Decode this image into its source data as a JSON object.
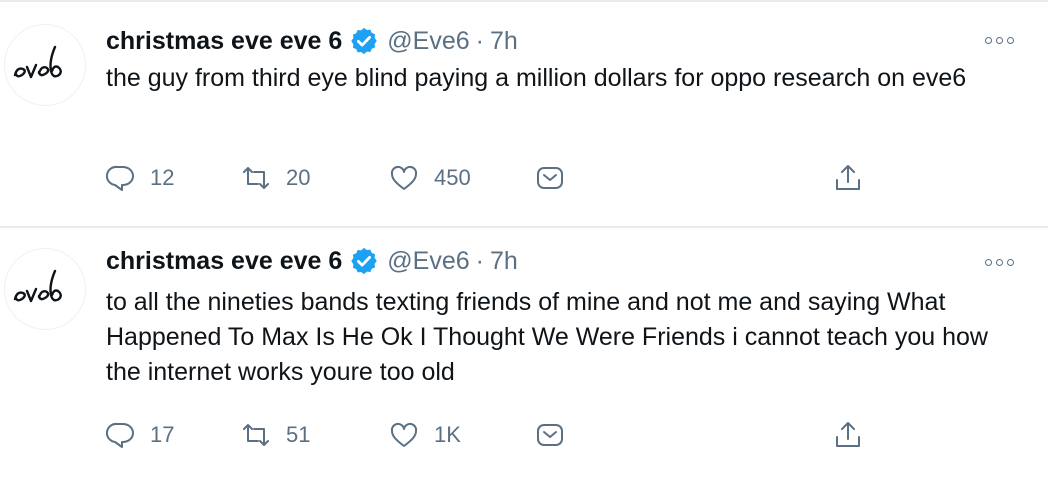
{
  "tweets": [
    {
      "display_name": "christmas eve eve 6",
      "handle": "@Eve6",
      "separator": "·",
      "time": "7h",
      "text": "the guy from third eye blind paying a million dollars for oppo research on eve6",
      "replies": "12",
      "retweets": "20",
      "likes": "450",
      "avatar_text": "eve6"
    },
    {
      "display_name": "christmas eve eve 6",
      "handle": "@Eve6",
      "separator": "·",
      "time": "7h",
      "text": "to all the nineties bands texting friends of mine and not me and saying What Happened To Max Is He Ok I Thought We Were Friends i cannot teach you how the internet works youre too old",
      "replies": "17",
      "retweets": "51",
      "likes": "1K",
      "avatar_text": "eve6"
    }
  ],
  "icons": {
    "verified": "verified-badge-icon",
    "more": "more-options-icon",
    "reply": "reply-icon",
    "retweet": "retweet-icon",
    "like": "heart-icon",
    "share": "share-icon",
    "upload": "upload-icon"
  },
  "colors": {
    "text": "#0f1419",
    "secondary": "#5b7083",
    "verified": "#1da1f2",
    "divider": "#e6ecf0"
  }
}
